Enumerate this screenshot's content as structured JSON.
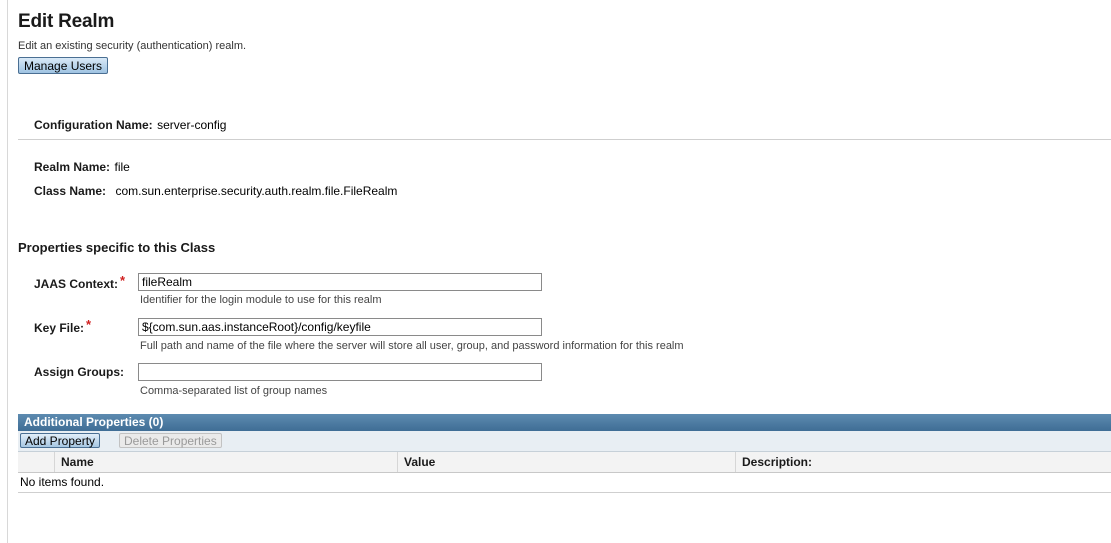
{
  "header": {
    "title": "Edit Realm",
    "subtitle": "Edit an existing security (authentication) realm.",
    "manage_users_label": "Manage Users"
  },
  "config": {
    "label": "Configuration Name:",
    "value": "server-config"
  },
  "realm": {
    "name_label": "Realm Name:",
    "name_value": "file",
    "class_label": "Class Name:",
    "class_value": "com.sun.enterprise.security.auth.realm.file.FileRealm"
  },
  "properties": {
    "section_title": "Properties specific to this Class",
    "required_marker": "*",
    "fields": [
      {
        "label": "JAAS Context:",
        "value": "fileRealm",
        "help": "Identifier for the login module to use for this realm",
        "required": true
      },
      {
        "label": "Key File:",
        "value": "${com.sun.aas.instanceRoot}/config/keyfile",
        "help": "Full path and name of the file where the server will store all user, group, and password information for this realm",
        "required": true
      },
      {
        "label": "Assign Groups:",
        "value": "",
        "help": "Comma-separated list of group names",
        "required": false
      }
    ]
  },
  "additional": {
    "title": "Additional Properties (0)",
    "add_label": "Add Property",
    "delete_label": "Delete Properties",
    "columns": [
      "Name",
      "Value",
      "Description:"
    ],
    "empty_text": "No items found."
  },
  "colors": {
    "table_header": "#3f6d95",
    "required": "#d02020",
    "button_border": "#4a6f93"
  }
}
